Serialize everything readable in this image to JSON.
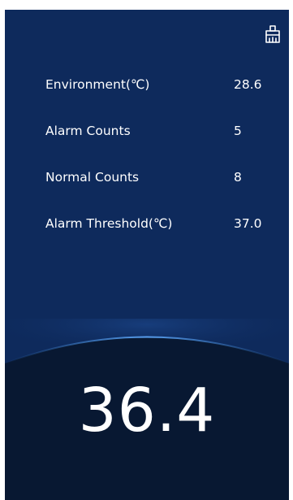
{
  "colors": {
    "background": "#0e2a5c",
    "panel_bottom": "#081832",
    "arc_glow": "#3f8be3",
    "text": "#ffffff"
  },
  "toolbar": {
    "clean_icon": "broom-icon"
  },
  "stats": [
    {
      "label": "Environment(℃)",
      "value": "28.6"
    },
    {
      "label": "Alarm Counts",
      "value": "5"
    },
    {
      "label": "Normal Counts",
      "value": "8"
    },
    {
      "label": "Alarm Threshold(℃)",
      "value": "37.0"
    }
  ],
  "reading": {
    "temperature": "36.4"
  }
}
